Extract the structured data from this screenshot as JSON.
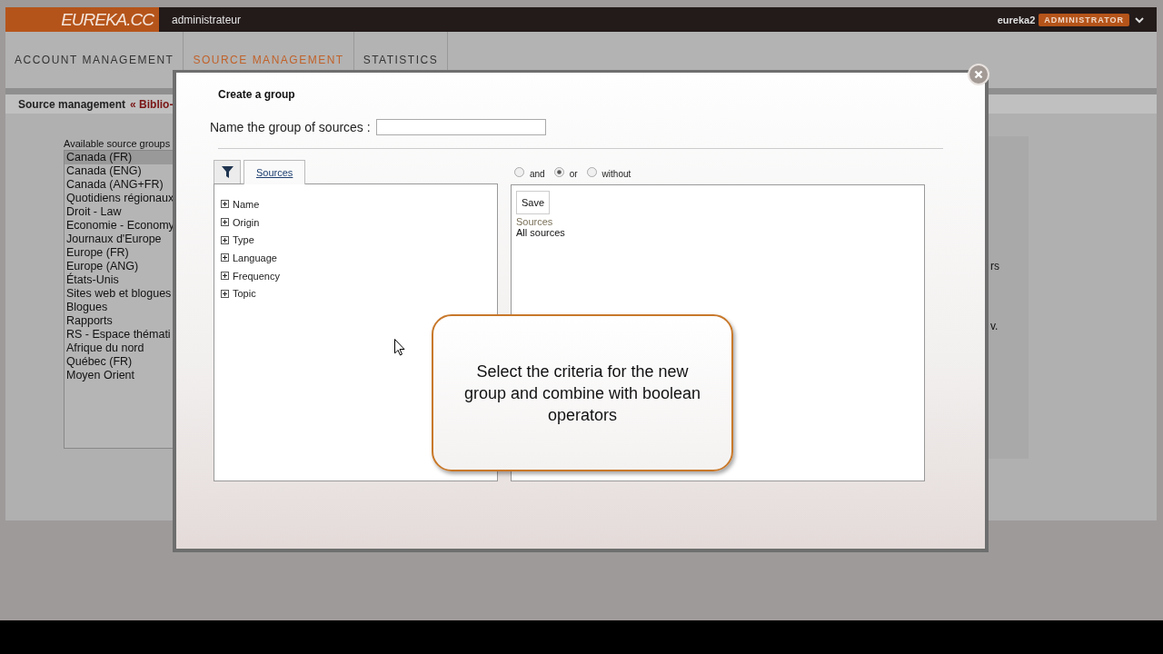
{
  "header": {
    "logo": "EUREKA.CC",
    "context": "administrateur",
    "user": "eureka2",
    "role_badge": "ADMINISTRATOR"
  },
  "nav_tabs": [
    {
      "label": "ACCOUNT MANAGEMENT",
      "selected": false
    },
    {
      "label": "SOURCE MANAGEMENT",
      "selected": true
    },
    {
      "label": "STATISTICS",
      "selected": false
    }
  ],
  "breadcrumb": {
    "current": "Source management",
    "link": "« Biblio-"
  },
  "source_groups": {
    "label": "Available source groups",
    "items": [
      {
        "label": "Canada (FR)",
        "selected": true
      },
      {
        "label": "Canada (ENG)",
        "selected": false
      },
      {
        "label": "Canada (ANG+FR)",
        "selected": false
      },
      {
        "label": "Quotidiens régionaux",
        "selected": false
      },
      {
        "label": "Droit - Law",
        "selected": false
      },
      {
        "label": "Economie - Economy",
        "selected": false
      },
      {
        "label": "Journaux d'Europe",
        "selected": false
      },
      {
        "label": "Europe (FR)",
        "selected": false
      },
      {
        "label": "Europe (ANG)",
        "selected": false
      },
      {
        "label": "États-Unis",
        "selected": false
      },
      {
        "label": "Sites web et blogues",
        "selected": false
      },
      {
        "label": "Blogues",
        "selected": false
      },
      {
        "label": "Rapports",
        "selected": false
      },
      {
        "label": "RS - Espace thémati",
        "selected": false
      },
      {
        "label": "Afrique du nord",
        "selected": false
      },
      {
        "label": "Québec (FR)",
        "selected": false
      },
      {
        "label": "Moyen Orient",
        "selected": false
      }
    ]
  },
  "side_fragments": [
    "rs",
    "v."
  ],
  "dialog": {
    "title": "Create a group",
    "name_label": "Name the group of sources :",
    "tabs": [
      {
        "kind": "filter",
        "selected": false
      },
      {
        "kind": "text",
        "label": "Sources",
        "selected": true
      }
    ],
    "criteria": [
      {
        "label": "Name",
        "expanded": false
      },
      {
        "label": "Origin",
        "expanded": false
      },
      {
        "label": "Type",
        "expanded": false
      },
      {
        "label": "Language",
        "expanded": false
      },
      {
        "label": "Frequency",
        "expanded": false
      },
      {
        "label": "Topic",
        "expanded": false
      }
    ],
    "operators": [
      {
        "label": "and",
        "selected": false
      },
      {
        "label": "or",
        "selected": true
      },
      {
        "label": "without",
        "selected": false
      }
    ],
    "save_button": "Save",
    "result_heading": "Sources",
    "result_value": "All sources"
  },
  "callout": "Select the criteria for the new group and combine with boolean operators"
}
